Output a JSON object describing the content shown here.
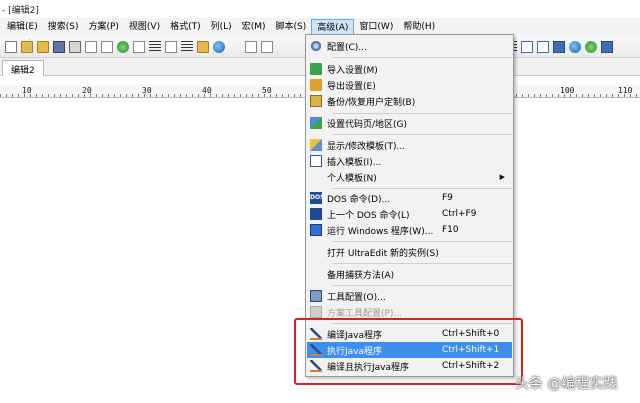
{
  "window": {
    "title": "- [编辑2]"
  },
  "menubar": {
    "items": [
      {
        "label": "编辑(E)"
      },
      {
        "label": "搜索(S)"
      },
      {
        "label": "方案(P)"
      },
      {
        "label": "视图(V)"
      },
      {
        "label": "格式(T)"
      },
      {
        "label": "列(L)"
      },
      {
        "label": "宏(M)"
      },
      {
        "label": "脚本(S)"
      },
      {
        "label": "高级(A)",
        "active": true
      },
      {
        "label": "窗口(W)"
      },
      {
        "label": "帮助(H)"
      }
    ]
  },
  "tabs": [
    {
      "label": "编辑2"
    }
  ],
  "ruler": {
    "labels": [
      "10",
      "20",
      "30",
      "40",
      "50",
      "100",
      "110"
    ]
  },
  "dropdown": {
    "items": {
      "config": {
        "label": "配置(C)...",
        "icon": "gear-icon"
      },
      "import_settings": {
        "label": "导入设置(M)",
        "icon": "import-icon"
      },
      "export_settings": {
        "label": "导出设置(E)",
        "icon": "export-icon"
      },
      "backup": {
        "label": "备份/恢复用户定制(B)",
        "icon": "backup-icon"
      },
      "codepage": {
        "label": "设置代码页/地区(G)",
        "icon": "region-icon"
      },
      "edit_template": {
        "label": "显示/修改模板(T)...",
        "icon": "template-icon"
      },
      "insert_template": {
        "label": "插入模板(I)...",
        "icon": "insert-template-icon"
      },
      "personal_template": {
        "label": "个人模板(N)",
        "submenu_arrow": "▶"
      },
      "dos_command": {
        "label": "DOS 命令(D)...",
        "shortcut": "F9",
        "icon": "dos-icon",
        "icon_text": "DOS"
      },
      "last_dos": {
        "label": "上一个 DOS 命令(L)",
        "shortcut": "Ctrl+F9",
        "icon": "dos-repeat-icon"
      },
      "run_windows": {
        "label": "运行 Windows 程序(W)...",
        "shortcut": "F10",
        "icon": "run-icon"
      },
      "new_instance": {
        "label": "打开 UltraEdit 新的实例(S)"
      },
      "capture": {
        "label": "备用捕获方法(A)"
      },
      "tool_config": {
        "label": "工具配置(O)...",
        "icon": "tool-config-icon"
      },
      "project_tool": {
        "label": "方案工具配置(P)...",
        "icon": "project-tool-icon",
        "disabled": true
      },
      "compile_java": {
        "label": "编译Java程序",
        "shortcut": "Ctrl+Shift+0",
        "icon": "java-tool-icon"
      },
      "run_java": {
        "label": "执行Java程序",
        "shortcut": "Ctrl+Shift+1",
        "icon": "java-tool-icon",
        "selected": true
      },
      "compile_run_java": {
        "label": "编译且执行Java程序",
        "shortcut": "Ctrl+Shift+2",
        "icon": "java-tool-icon"
      }
    }
  },
  "watermark": {
    "text": "头条 @编程实践"
  },
  "colors": {
    "selected": "#3e8ef0",
    "highlight_border": "#e02020",
    "menu_bg": "#f2f2f2"
  }
}
